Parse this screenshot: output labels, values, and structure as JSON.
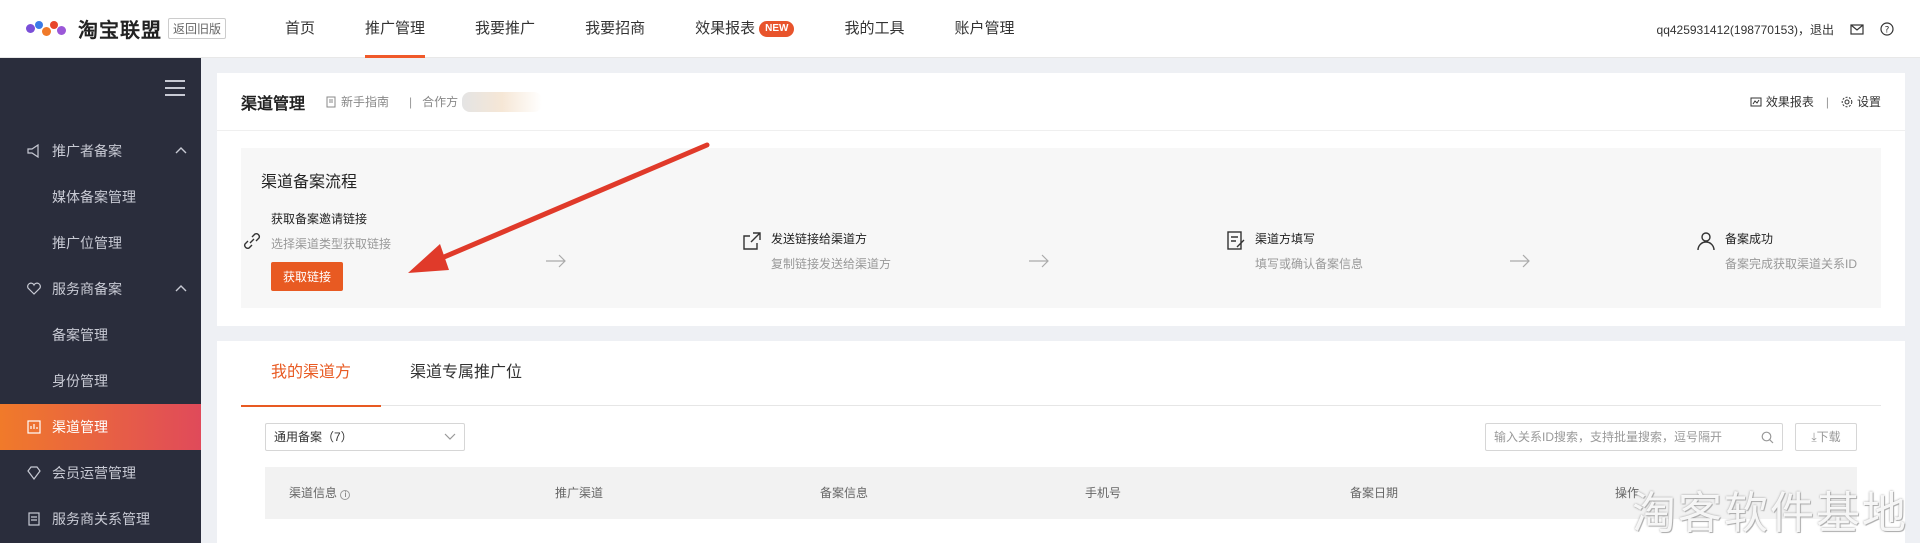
{
  "header": {
    "logo_text": "淘宝联盟",
    "back_old": "返回旧版",
    "nav": [
      {
        "label": "首页"
      },
      {
        "label": "推广管理",
        "active": true
      },
      {
        "label": "我要推广"
      },
      {
        "label": "我要招商"
      },
      {
        "label": "效果报表",
        "badge": "NEW"
      },
      {
        "label": "我的工具"
      },
      {
        "label": "账户管理"
      }
    ],
    "user": "qq425931412(198770153)，退出",
    "icons": [
      "mail-icon",
      "help-icon"
    ]
  },
  "sidebar": {
    "groups": [
      {
        "label": "推广者备案",
        "icon": "megaphone-icon",
        "expanded": true
      },
      {
        "label": "媒体备案管理"
      },
      {
        "label": "推广位管理"
      },
      {
        "label": "服务商备案",
        "icon": "heart-hand-icon",
        "expanded": true
      },
      {
        "label": "备案管理"
      },
      {
        "label": "身份管理"
      },
      {
        "label": "渠道管理",
        "icon": "channel-icon",
        "active": true
      },
      {
        "label": "会员运营管理",
        "icon": "diamond-icon"
      },
      {
        "label": "服务商关系管理",
        "icon": "doc-icon"
      }
    ]
  },
  "page": {
    "title": "渠道管理",
    "guide": "新手指南",
    "partner_label": "合作方",
    "report_link": "效果报表",
    "settings_link": "设置"
  },
  "flow": {
    "title": "渠道备案流程",
    "steps": [
      {
        "title": "获取备案邀请链接",
        "desc": "选择渠道类型获取链接",
        "button": "获取链接",
        "icon": "link-icon"
      },
      {
        "title": "发送链接给渠道方",
        "desc": "复制链接发送给渠道方",
        "icon": "share-icon"
      },
      {
        "title": "渠道方填写",
        "desc": "填写或确认备案信息",
        "icon": "edit-doc-icon"
      },
      {
        "title": "备案成功",
        "desc": "备案完成获取渠道关系ID",
        "icon": "user-icon"
      }
    ]
  },
  "list": {
    "tabs": [
      "我的渠道方",
      "渠道专属推广位"
    ],
    "active_tab": 0,
    "filter_value": "通用备案（7）",
    "search_placeholder": "输入关系ID搜索，支持批量搜索，逗号隔开",
    "download_label": "下载",
    "columns": [
      "渠道信息",
      "推广渠道",
      "备案信息",
      "手机号",
      "备案日期",
      "操作"
    ]
  },
  "watermark": "淘客软件基地",
  "colors": {
    "accent": "#e85a22",
    "sidebar_bg": "#2a2d3c",
    "arrow": "#e03a2a"
  }
}
